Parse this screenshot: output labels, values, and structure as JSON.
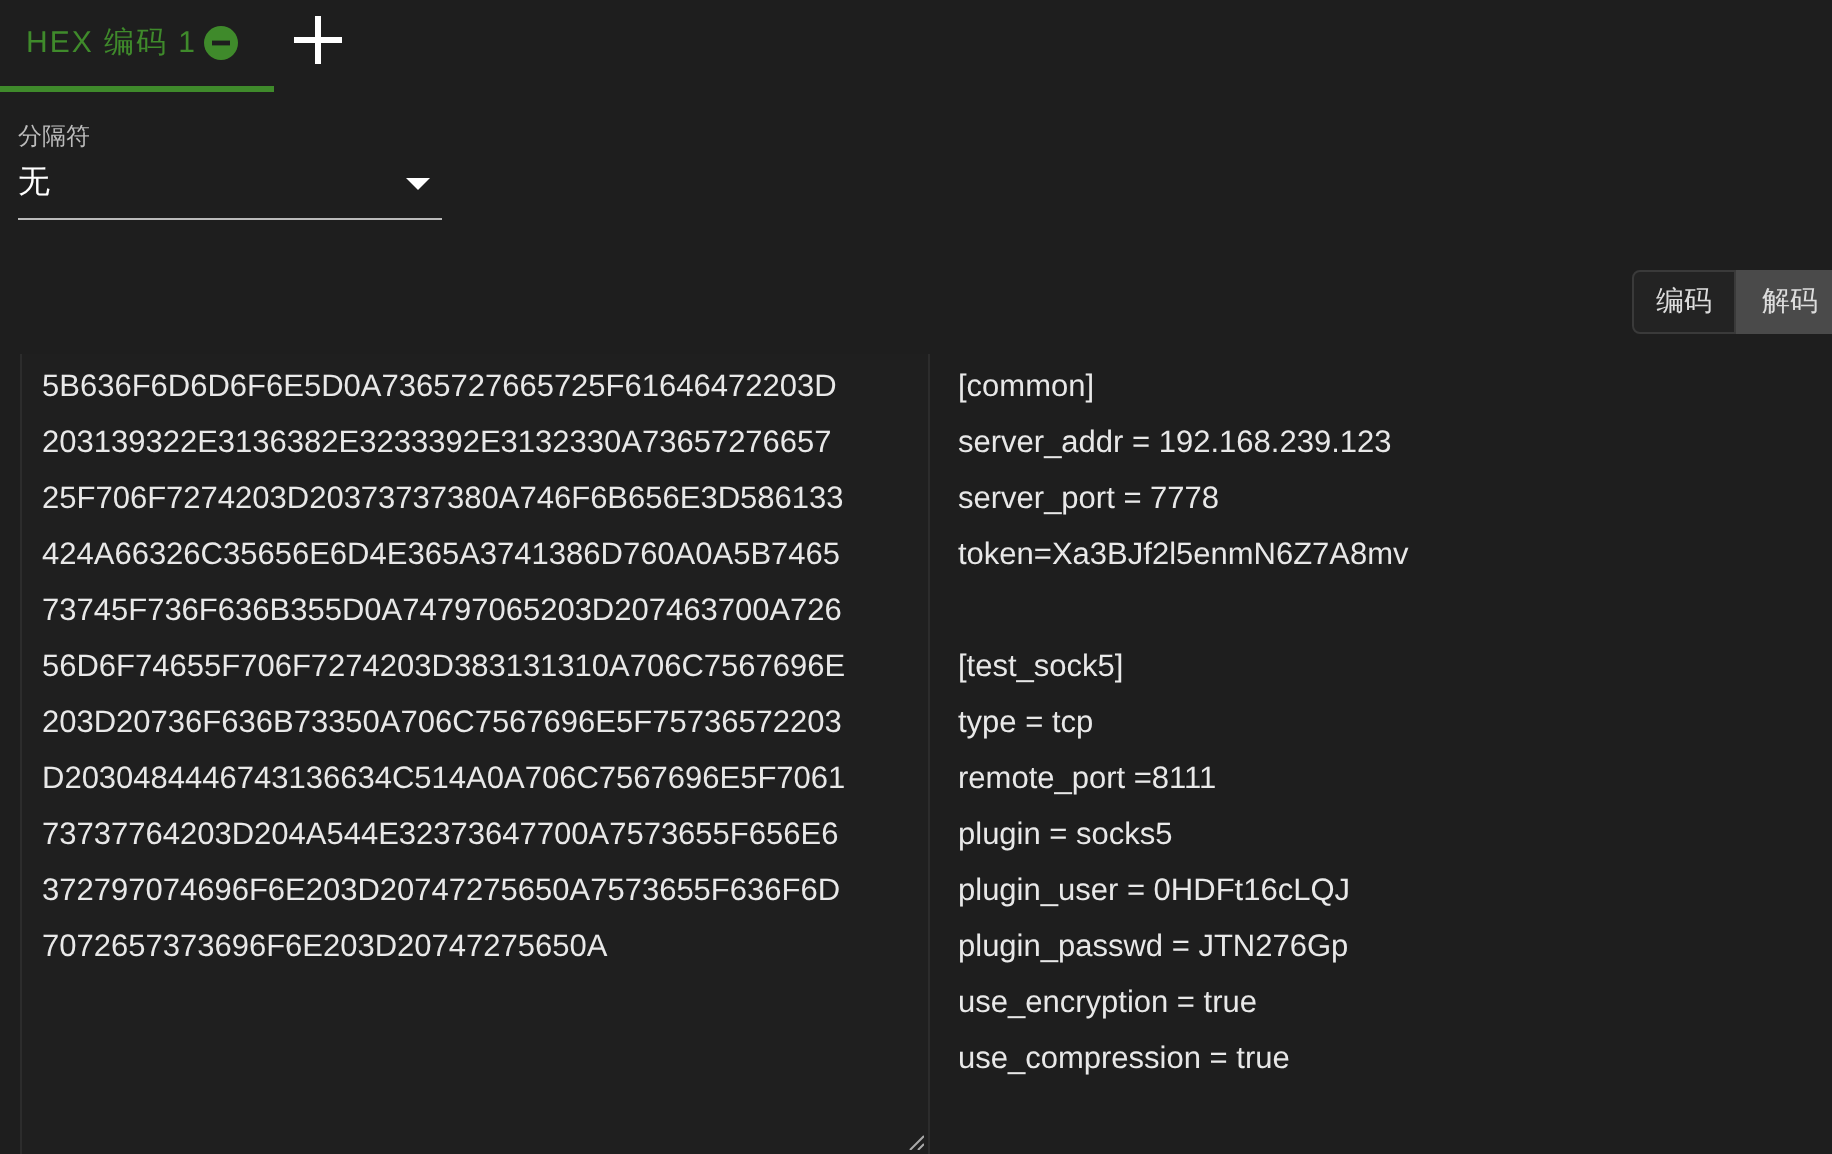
{
  "tabs": [
    {
      "label": "HEX 编码 1",
      "selected": true
    }
  ],
  "separator": {
    "label": "分隔符",
    "value": "无"
  },
  "mode_buttons": [
    {
      "label": "编码",
      "selected": false
    },
    {
      "label": "解码",
      "selected": true
    }
  ],
  "input": {
    "lines": [
      "5B636F6D6D6F6E5D0A7365727665725F61646472203D",
      "203139322E3136382E3233392E3132330A73657276657",
      "25F706F7274203D20373737380A746F6B656E3D586133",
      "424A66326C35656E6D4E365A3741386D760A0A5B7465",
      "73745F736F636B355D0A74797065203D207463700A726",
      "56D6F74655F706F7274203D383131310A706C7567696E",
      "203D20736F636B73350A706C7567696E5F75736572203",
      "D2030484446743136634C514A0A706C7567696E5F7061",
      "73737764203D204A544E32373647700A7573655F656E6",
      "372797074696F6E203D20747275650A7573655F636F6D",
      "7072657373696F6E203D20747275650A"
    ]
  },
  "output": {
    "sections": [
      {
        "lines": [
          "[common]",
          "server_addr = 192.168.239.123",
          "server_port = 7778",
          "token=Xa3BJf2l5enmN6Z7A8mv"
        ]
      },
      {
        "lines": [
          "[test_sock5]",
          "type = tcp",
          "remote_port =8111",
          "plugin = socks5",
          "plugin_user = 0HDFt16cLQJ",
          "plugin_passwd = JTN276Gp",
          "use_encryption = true",
          "use_compression = true"
        ]
      }
    ]
  }
}
